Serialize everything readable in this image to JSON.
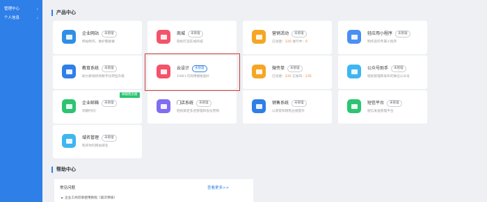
{
  "sidebar": {
    "items": [
      {
        "label": "管理中心",
        "has_arrow": true
      },
      {
        "label": "个人信息",
        "has_arrow": true
      }
    ],
    "color": "#2f7fe8"
  },
  "product_section": {
    "title": "产品中心"
  },
  "cards": [
    {
      "name": "企业网站",
      "badge": "未管理",
      "desc": "网站制作、维护都能做",
      "icon": "website-icon",
      "color": "#2f8ee8"
    },
    {
      "name": "商城",
      "badge": "未管理",
      "desc": "轻松打造在线商城",
      "icon": "shop-bag-icon",
      "color": "#f4536a"
    },
    {
      "name": "营销活动",
      "badge": "未管理",
      "desc_prefix": "已创建：",
      "desc_num1": "120",
      "desc_mid": "   进行中：",
      "desc_num2": "0",
      "icon": "marketing-icon",
      "color": "#f5a623"
    },
    {
      "name": "轻应用小程序",
      "badge": "未管理",
      "desc": "制作您的专属小程序",
      "icon": "mini-program-icon",
      "color": "#4a8ff2"
    },
    {
      "name": "教育系统",
      "badge": "未管理",
      "desc": "助力教培机构数字化转型升级",
      "icon": "education-book-icon",
      "color": "#2f7fe8"
    },
    {
      "name": "云设计",
      "badge": "未管理",
      "desc": "10W+可商用模板图片",
      "icon": "design-image-icon",
      "color": "#f4536a",
      "highlight": true
    },
    {
      "name": "微传单",
      "badge": "未管理",
      "desc_prefix": "已创建：",
      "desc_num1": "235",
      "desc_mid": "   已发布：",
      "desc_num2": "235",
      "icon": "flyer-icon",
      "color": "#f5a623"
    },
    {
      "name": "公众号助手",
      "badge": "未管理",
      "desc": "轻松管理和发布的微信公众号",
      "icon": "wechat-assistant-icon",
      "color": "#3fb6f0"
    },
    {
      "name": "企业邮箱",
      "badge": "未管理",
      "desc": "到期时间：",
      "icon": "mail-icon",
      "color": "#2cc470",
      "ribbon": "邮箱售卖版"
    },
    {
      "name": "门店系统",
      "badge": "未管理",
      "desc": "轻松搞定多店管理和会员营销",
      "icon": "store-icon",
      "color": "#7f6df2"
    },
    {
      "name": "销售系统",
      "badge": "未管理",
      "desc": "以获客和销售业绩提升",
      "icon": "sales-icon",
      "color": "#2f7fe8"
    },
    {
      "name": "短信平台",
      "badge": "未管理",
      "desc": "短信发送管理平台",
      "icon": "sms-icon",
      "color": "#2cc470"
    },
    {
      "name": "域名管理",
      "badge": "未管理",
      "desc": "购买你的网站域名",
      "icon": "domain-icon",
      "color": "#3fb6f0"
    }
  ],
  "help_section": {
    "title": "帮助中心",
    "header": "常见问题",
    "more": "查看更多>>",
    "items": [
      "企业工商印章使用教程（第次审核）"
    ]
  }
}
